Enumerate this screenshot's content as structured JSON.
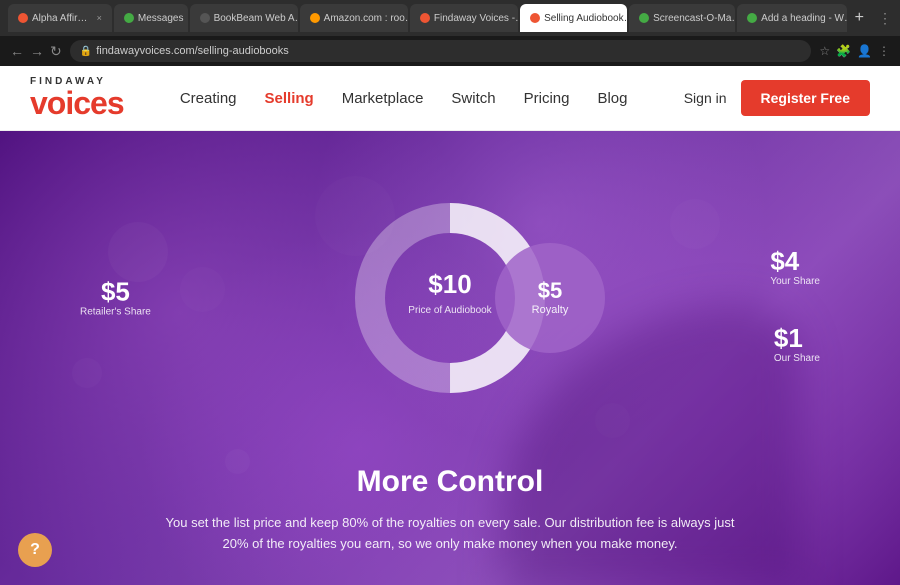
{
  "browser": {
    "tabs": [
      {
        "id": "alpha",
        "label": "Alpha Affirmation…",
        "icon": "alpha",
        "active": false,
        "close": "×"
      },
      {
        "id": "messages",
        "label": "Messages",
        "icon": "messages",
        "active": false,
        "close": "×"
      },
      {
        "id": "bookbeam",
        "label": "BookBeam Web A…",
        "icon": "bookbeam",
        "active": false,
        "close": "×"
      },
      {
        "id": "amazon",
        "label": "Amazon.com : roo…",
        "icon": "amazon",
        "active": false,
        "close": "×"
      },
      {
        "id": "findaway",
        "label": "Findaway Voices -…",
        "icon": "findaway",
        "active": false,
        "close": "×"
      },
      {
        "id": "selling",
        "label": "Selling Audiobook…",
        "icon": "selling",
        "active": true,
        "close": "×"
      },
      {
        "id": "screencast",
        "label": "Screencast-O-Ma…",
        "icon": "screencast",
        "active": false,
        "close": "×"
      },
      {
        "id": "google",
        "label": "Add a heading - W…",
        "icon": "google",
        "active": false,
        "close": "×"
      }
    ],
    "new_tab_label": "+",
    "url": "findawayvoices.com/selling-audiobooks"
  },
  "navbar": {
    "logo_top": "FINDAWAY",
    "logo_bottom": "voices",
    "nav_items": [
      {
        "id": "creating",
        "label": "Creating",
        "active": false
      },
      {
        "id": "selling",
        "label": "Selling",
        "active": true
      },
      {
        "id": "marketplace",
        "label": "Marketplace",
        "active": false
      },
      {
        "id": "switch",
        "label": "Switch",
        "active": false
      },
      {
        "id": "pricing",
        "label": "Pricing",
        "active": false
      },
      {
        "id": "blog",
        "label": "Blog",
        "active": false
      }
    ],
    "sign_in": "Sign in",
    "register": "Register Free"
  },
  "hero": {
    "retailer_amount": "$5",
    "retailer_label": "Retailer's Share",
    "price_amount": "$10",
    "price_label": "Price of Audiobook",
    "royalty_amount": "$5",
    "royalty_label": "Royalty",
    "your_share_amount": "$4",
    "your_share_label": "Your Share",
    "our_share_amount": "$1",
    "our_share_label": "Our Share"
  },
  "more_control": {
    "title": "More Control",
    "body": "You set the list price and keep 80% of the royalties on every sale. Our distribution fee is always just 20% of the royalties you earn, so we only make money when you make money."
  },
  "help": {
    "label": "?"
  }
}
